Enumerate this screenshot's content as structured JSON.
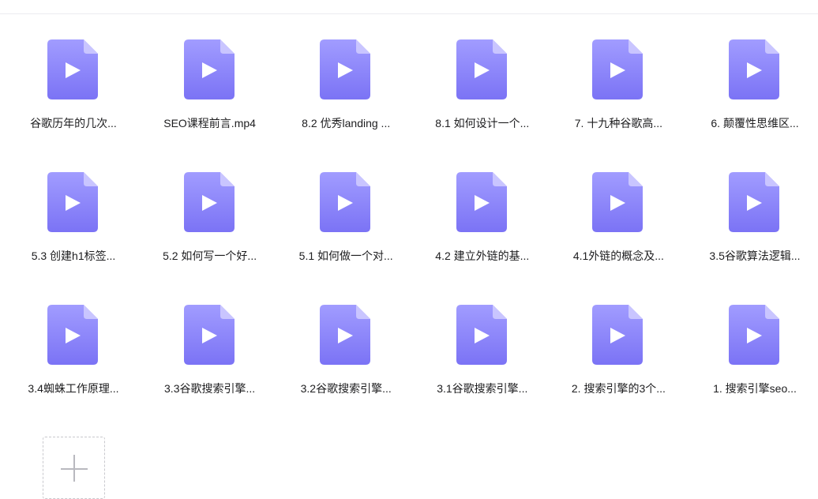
{
  "files": [
    {
      "name": "谷歌历年的几次...",
      "type": "video-file-icon"
    },
    {
      "name": "SEO课程前言.mp4",
      "type": "video-file-icon"
    },
    {
      "name": "8.2 优秀landing ...",
      "type": "video-file-icon"
    },
    {
      "name": "8.1 如何设计一个...",
      "type": "video-file-icon"
    },
    {
      "name": "7. 十九种谷歌高...",
      "type": "video-file-icon"
    },
    {
      "name": "6. 颠覆性思维区...",
      "type": "video-file-icon"
    },
    {
      "name": "5.3 创建h1标签...",
      "type": "video-file-icon"
    },
    {
      "name": "5.2 如何写一个好...",
      "type": "video-file-icon"
    },
    {
      "name": "5.1 如何做一个对...",
      "type": "video-file-icon"
    },
    {
      "name": "4.2 建立外链的基...",
      "type": "video-file-icon"
    },
    {
      "name": "4.1外链的概念及...",
      "type": "video-file-icon"
    },
    {
      "name": "3.5谷歌算法逻辑...",
      "type": "video-file-icon"
    },
    {
      "name": "3.4蜘蛛工作原理...",
      "type": "video-file-icon"
    },
    {
      "name": "3.3谷歌搜索引擎...",
      "type": "video-file-icon"
    },
    {
      "name": "3.2谷歌搜索引擎...",
      "type": "video-file-icon"
    },
    {
      "name": "3.1谷歌搜索引擎...",
      "type": "video-file-icon"
    },
    {
      "name": "2. 搜索引擎的3个...",
      "type": "video-file-icon"
    },
    {
      "name": "1. 搜索引擎seo...",
      "type": "video-file-icon"
    }
  ],
  "add_tile": {
    "icon": "plus-icon"
  },
  "colors": {
    "icon_top": "#a19cff",
    "icon_bottom": "#7b73f5",
    "icon_fold": "#c9c5ff",
    "play": "#ffffff"
  }
}
